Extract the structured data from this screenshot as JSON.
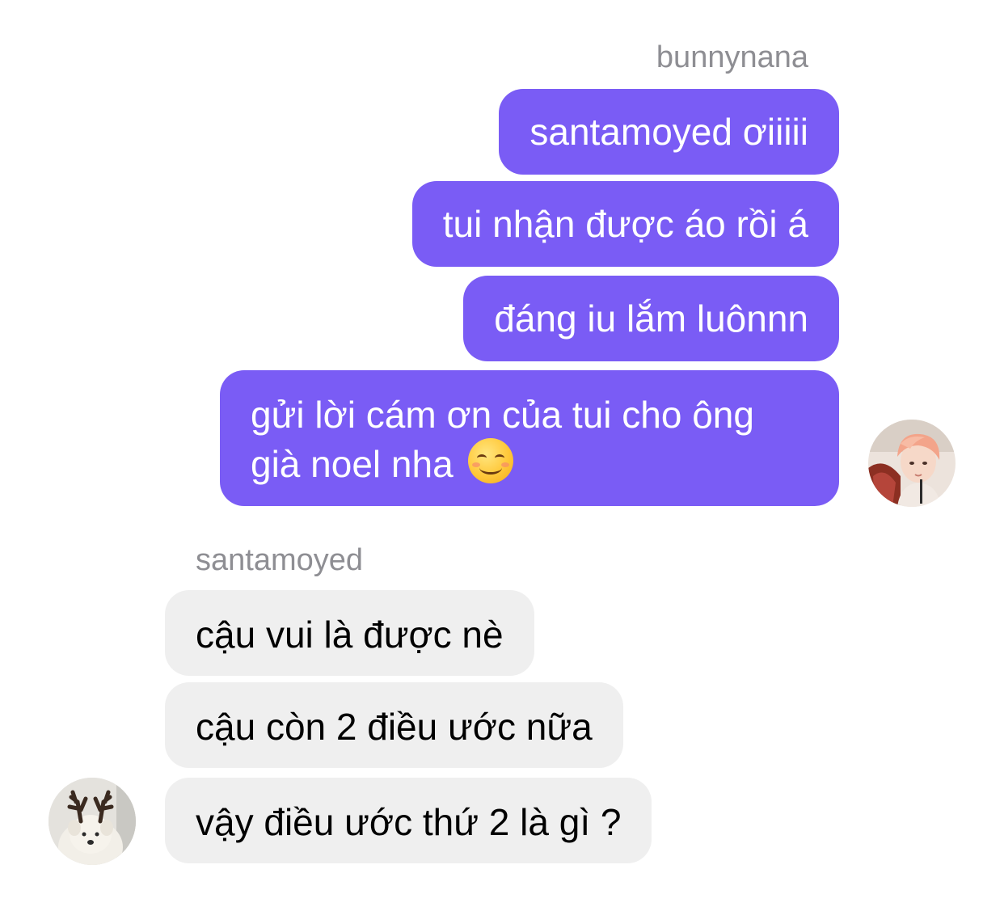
{
  "outgoing": {
    "sender": "bunnynana",
    "messages": [
      "santamoyed ơiiiii",
      "tui nhận được áo rồi á",
      "đáng iu lắm luônnn",
      "gửi lời cám ơn của tui cho ông",
      "già noel nha"
    ],
    "emoji": "smiling-face-with-smiling-eyes"
  },
  "incoming": {
    "sender": "santamoyed",
    "messages": [
      "cậu vui là được nè",
      "cậu còn 2 điều ước nữa",
      "vậy điều ước thứ 2 là gì ?"
    ]
  },
  "colors": {
    "outgoing_bubble": "#7a5cf5",
    "incoming_bubble": "#efefef",
    "sender_name": "#8e8e93"
  }
}
